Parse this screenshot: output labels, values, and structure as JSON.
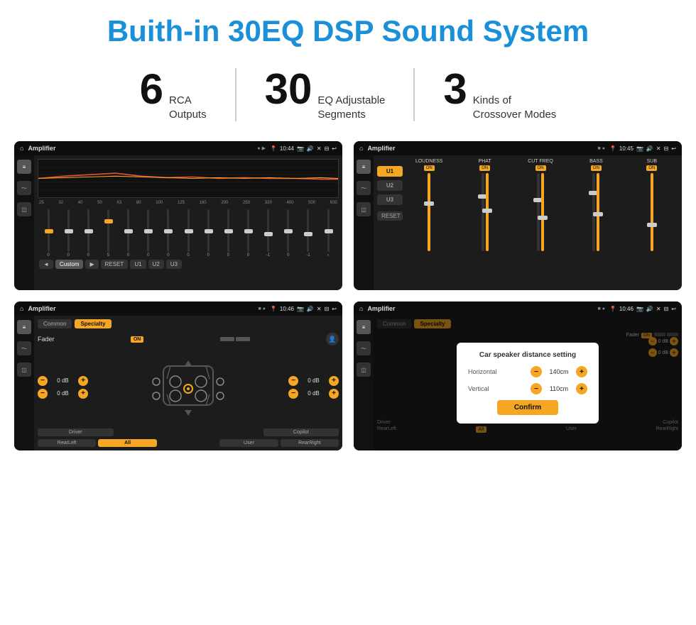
{
  "header": {
    "title": "Buith-in 30EQ DSP Sound System"
  },
  "stats": [
    {
      "number": "6",
      "label_line1": "RCA",
      "label_line2": "Outputs"
    },
    {
      "number": "30",
      "label_line1": "EQ Adjustable",
      "label_line2": "Segments"
    },
    {
      "number": "3",
      "label_line1": "Kinds of",
      "label_line2": "Crossover Modes"
    }
  ],
  "screen1": {
    "status": "Amplifier",
    "time": "10:44",
    "eq_freqs": [
      "25",
      "32",
      "40",
      "50",
      "63",
      "80",
      "100",
      "125",
      "160",
      "200",
      "250",
      "320",
      "400",
      "500",
      "630"
    ],
    "eq_values": [
      "0",
      "0",
      "0",
      "5",
      "0",
      "0",
      "0",
      "0",
      "0",
      "0",
      "0",
      "-1",
      "0",
      "-1"
    ],
    "eq_preset": "Custom",
    "buttons": [
      "◄",
      "Custom",
      "▶",
      "RESET",
      "U1",
      "U2",
      "U3"
    ]
  },
  "screen2": {
    "status": "Amplifier",
    "time": "10:45",
    "presets": [
      "U1",
      "U2",
      "U3"
    ],
    "channels": [
      "LOUDNESS",
      "PHAT",
      "CUT FREQ",
      "BASS",
      "SUB"
    ],
    "toggles": [
      "ON",
      "ON",
      "ON",
      "ON",
      "ON"
    ],
    "reset_label": "RESET"
  },
  "screen3": {
    "status": "Amplifier",
    "time": "10:46",
    "tabs": [
      "Common",
      "Specialty"
    ],
    "active_tab": "Specialty",
    "fader_label": "Fader",
    "fader_on": "ON",
    "volumes": [
      "0 dB",
      "0 dB",
      "0 dB",
      "0 dB"
    ],
    "bottom_btns": [
      "Driver",
      "",
      "",
      "",
      "Copilot",
      "RearLeft",
      "All",
      "",
      "User",
      "RearRight"
    ]
  },
  "screen4": {
    "status": "Amplifier",
    "time": "10:46",
    "tabs": [
      "Common",
      "Specialty"
    ],
    "dialog_title": "Car speaker distance setting",
    "horizontal_label": "Horizontal",
    "horizontal_value": "140cm",
    "vertical_label": "Vertical",
    "vertical_value": "110cm",
    "confirm_label": "Confirm",
    "volumes": [
      "0 dB",
      "0 dB"
    ],
    "bottom_btns": [
      "Driver",
      "",
      "Copilot",
      "RearLeft",
      "All",
      "User",
      "RearRight"
    ]
  },
  "icons": {
    "home": "⌂",
    "location": "📍",
    "sound": "🔊",
    "back": "↩",
    "equalizer": "≡",
    "wave": "〜",
    "speaker": "📢",
    "camera": "📷",
    "minus": "−",
    "plus": "+"
  }
}
